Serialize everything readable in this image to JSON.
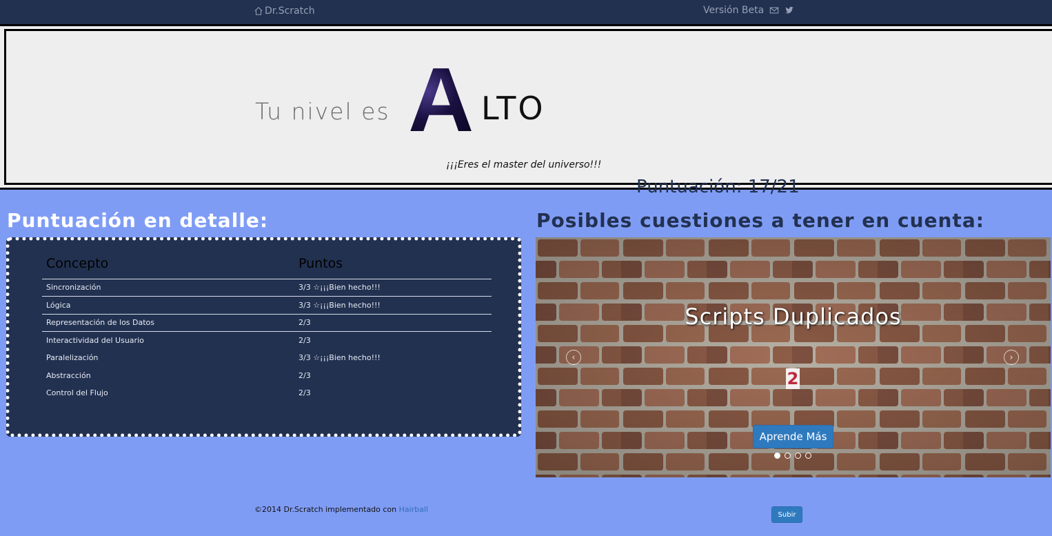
{
  "nav": {
    "brand": "Dr.Scratch",
    "version": "Versión Beta"
  },
  "level": {
    "prefix": "Tu nivel es",
    "letter": "A",
    "rest": "LTO",
    "message": "¡¡¡Eres el master del universo!!!",
    "score": "Puntuación: 17/21"
  },
  "detail": {
    "title": "Puntuación en detalle:",
    "headers": {
      "concept": "Concepto",
      "points": "Puntos"
    },
    "rows": [
      {
        "concept": "Sincronización",
        "points": "3/3 ☆¡¡¡Bien hecho!!!"
      },
      {
        "concept": "Lógica",
        "points": "3/3 ☆¡¡¡Bien hecho!!!"
      },
      {
        "concept": "Representación de los Datos",
        "points": "2/3"
      },
      {
        "concept": "Interactividad del Usuario",
        "points": "2/3"
      },
      {
        "concept": "Paralelización",
        "points": "3/3 ☆¡¡¡Bien hecho!!!"
      },
      {
        "concept": "Abstracción",
        "points": "2/3"
      },
      {
        "concept": "Control del Flujo",
        "points": "2/3"
      }
    ]
  },
  "issues": {
    "title": "Posibles cuestiones a tener en cuenta:",
    "slide_title": "Scripts Duplicados",
    "slide_count": "2",
    "learn_button": "Aprende Más",
    "slide_count_total": 4,
    "active_slide": 1
  },
  "footer": {
    "text": "©2014 Dr.Scratch implementado con",
    "link": "Hairball",
    "up_button": "Subir"
  },
  "colors": {
    "navbar": "#223150",
    "page_bg": "#7f9cf5",
    "panel": "#223150",
    "button": "#2f7abf",
    "count_red": "#c0283f"
  }
}
